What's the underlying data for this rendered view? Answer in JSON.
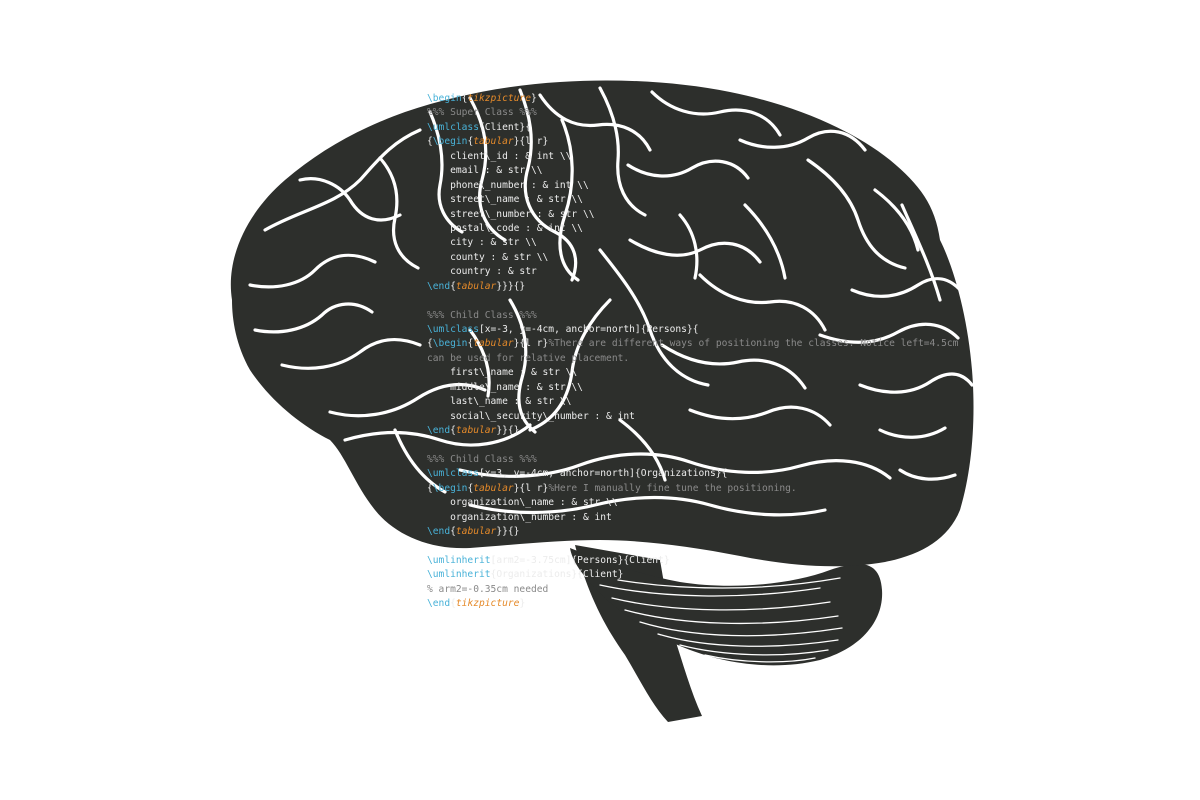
{
  "colors": {
    "background": "#ffffff",
    "brain_fill": "#2d2f2c",
    "sulci_stroke": "#ffffff",
    "code_keyword": "#49b2d8",
    "code_environment": "#e58a2a",
    "code_comment": "#8a8a8a",
    "code_text": "#ececec"
  },
  "code_lines": [
    [
      [
        "kw",
        "\\begin"
      ],
      [
        "tx",
        "{"
      ],
      [
        "env",
        "tikzpicture"
      ],
      [
        "tx",
        "}"
      ]
    ],
    [
      [
        "cm",
        "%%% Super Class %%%"
      ]
    ],
    [
      [
        "kw",
        "\\umlclass"
      ],
      [
        "tx",
        "{Client}{"
      ]
    ],
    [
      [
        "tx",
        "{"
      ],
      [
        "kw",
        "\\begin"
      ],
      [
        "tx",
        "{"
      ],
      [
        "env",
        "tabular"
      ],
      [
        "tx",
        "}{l r}"
      ]
    ],
    [
      [
        "tx",
        "    client\\_id : & int \\\\"
      ]
    ],
    [
      [
        "tx",
        "    email : & str \\\\"
      ]
    ],
    [
      [
        "tx",
        "    phone\\_number : & int \\\\"
      ]
    ],
    [
      [
        "tx",
        "    street\\_name : & str \\\\"
      ]
    ],
    [
      [
        "tx",
        "    street\\_number : & str \\\\"
      ]
    ],
    [
      [
        "tx",
        "    postal\\_code : & int \\\\"
      ]
    ],
    [
      [
        "tx",
        "    city : & str \\\\"
      ]
    ],
    [
      [
        "tx",
        "    county : & str \\\\"
      ]
    ],
    [
      [
        "tx",
        "    country : & str"
      ]
    ],
    [
      [
        "kw",
        "\\end"
      ],
      [
        "tx",
        "{"
      ],
      [
        "env",
        "tabular"
      ],
      [
        "tx",
        "}}}{}"
      ]
    ],
    [
      [
        "tx",
        ""
      ]
    ],
    [
      [
        "cm",
        "%%% Child Class %%%"
      ]
    ],
    [
      [
        "kw",
        "\\umlclass"
      ],
      [
        "tx",
        "[x=-3, y=-4cm, anchor=north]{Persons}{"
      ]
    ],
    [
      [
        "tx",
        "{"
      ],
      [
        "kw",
        "\\begin"
      ],
      [
        "tx",
        "{"
      ],
      [
        "env",
        "tabular"
      ],
      [
        "tx",
        "}{l r}"
      ],
      [
        "cm",
        "%There are different ways of positioning the classes. Notice left=4.5cm"
      ]
    ],
    [
      [
        "cm",
        "can be used for relative placement."
      ]
    ],
    [
      [
        "tx",
        "    first\\_name : & str \\\\"
      ]
    ],
    [
      [
        "tx",
        "    middle\\_name : & str \\\\"
      ]
    ],
    [
      [
        "tx",
        "    last\\_name : & str \\\\"
      ]
    ],
    [
      [
        "tx",
        "    social\\_security\\_number : & int"
      ]
    ],
    [
      [
        "kw",
        "\\end"
      ],
      [
        "tx",
        "{"
      ],
      [
        "env",
        "tabular"
      ],
      [
        "tx",
        "}}{}"
      ]
    ],
    [
      [
        "tx",
        ""
      ]
    ],
    [
      [
        "cm",
        "%%% Child Class %%%"
      ]
    ],
    [
      [
        "kw",
        "\\umlclass"
      ],
      [
        "tx",
        "[x=3, y=-4cm, anchor=north]{Organizations}{"
      ]
    ],
    [
      [
        "tx",
        "{"
      ],
      [
        "kw",
        "\\begin"
      ],
      [
        "tx",
        "{"
      ],
      [
        "env",
        "tabular"
      ],
      [
        "tx",
        "}{l r}"
      ],
      [
        "cm",
        "%Here I manually fine tune the positioning."
      ]
    ],
    [
      [
        "tx",
        "    organization\\_name : & str \\\\"
      ]
    ],
    [
      [
        "tx",
        "    organization\\_number : & int"
      ]
    ],
    [
      [
        "kw",
        "\\end"
      ],
      [
        "tx",
        "{"
      ],
      [
        "env",
        "tabular"
      ],
      [
        "tx",
        "}}{}"
      ]
    ],
    [
      [
        "tx",
        ""
      ]
    ],
    [
      [
        "kw",
        "\\umlinherit"
      ],
      [
        "tx",
        "[arm2=-3.75cm]{Persons}{Client}"
      ]
    ],
    [
      [
        "kw",
        "\\umlinherit"
      ],
      [
        "tx",
        "{Organizations}{Client}"
      ]
    ],
    [
      [
        "cm",
        "% arm2=-0.35cm needed"
      ]
    ],
    [
      [
        "kw",
        "\\end"
      ],
      [
        "tx",
        "{"
      ],
      [
        "env",
        "tikzpicture"
      ],
      [
        "tx",
        "}"
      ]
    ]
  ]
}
